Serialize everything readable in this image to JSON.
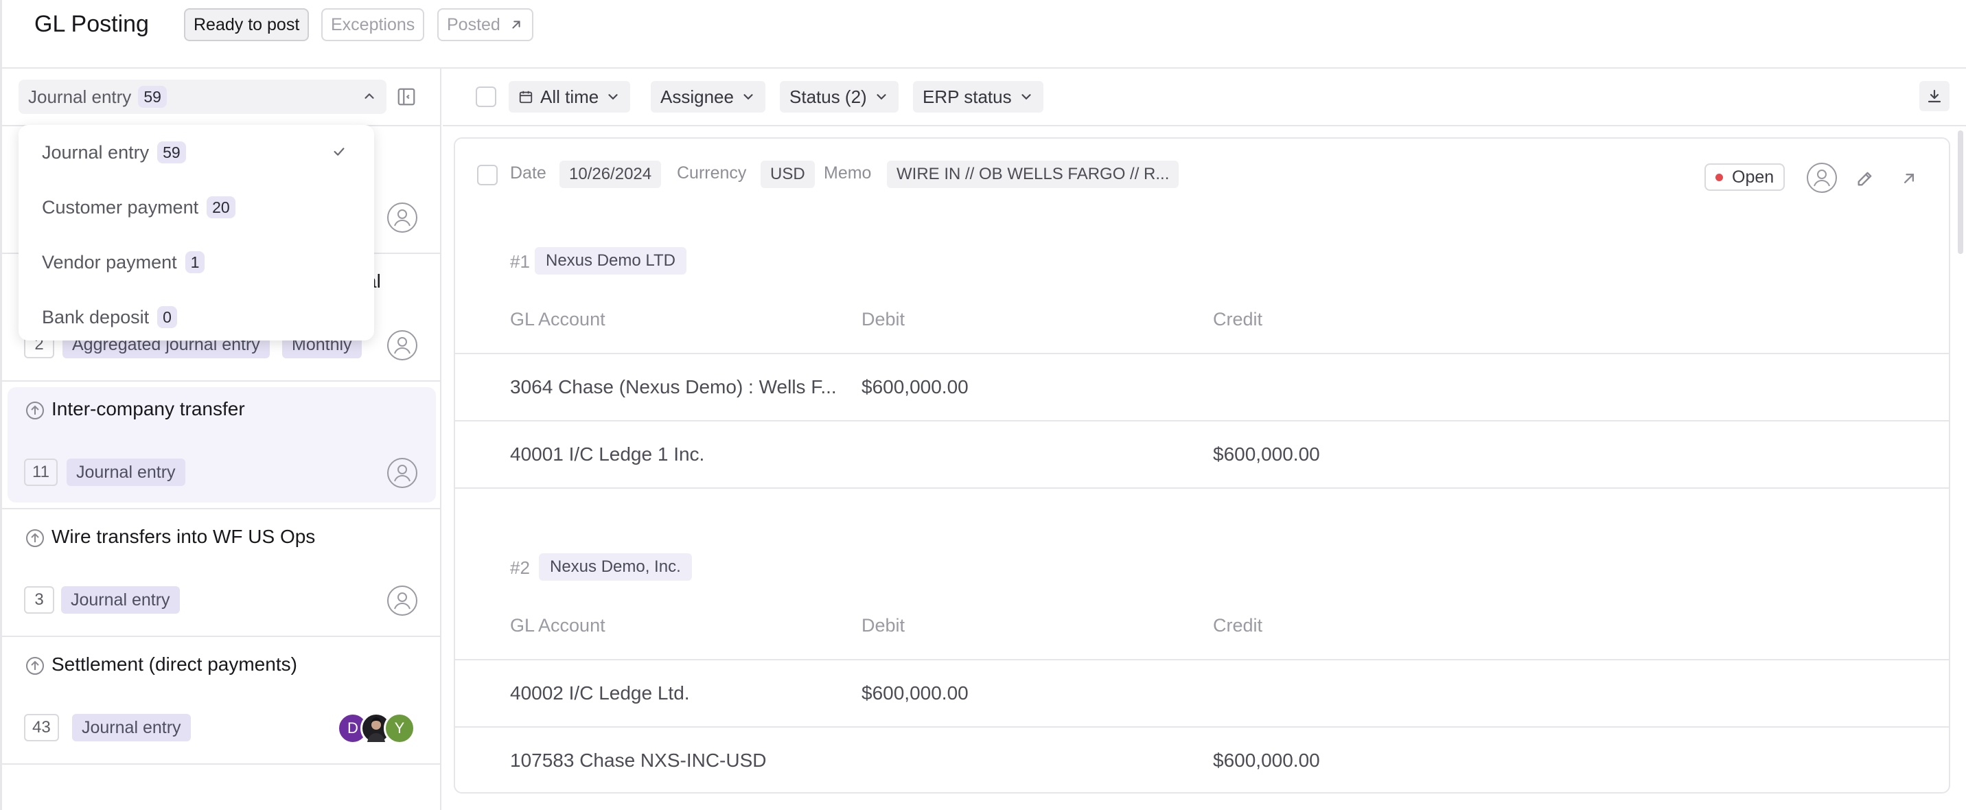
{
  "header": {
    "title": "GL Posting",
    "tabs": [
      {
        "label": "Ready to post",
        "active": true
      },
      {
        "label": "Exceptions",
        "active": false
      },
      {
        "label": "Posted",
        "active": false,
        "icon": "arrow-up-right-icon"
      }
    ]
  },
  "left": {
    "group_select": {
      "label": "Journal entry",
      "count": "59"
    },
    "dropdown": [
      {
        "label": "Journal entry",
        "count": "59",
        "checked": true
      },
      {
        "label": "Customer payment",
        "count": "20"
      },
      {
        "label": "Vendor payment",
        "count": "1"
      },
      {
        "label": "Bank deposit",
        "count": "0"
      }
    ],
    "items": [
      {
        "title": "",
        "count": "",
        "tags": []
      },
      {
        "title": "al",
        "count": "2",
        "tags": [
          "Aggregated journal entry",
          "Monthly"
        ]
      },
      {
        "title": "Inter-company transfer",
        "count": "11",
        "tags": [
          "Journal entry"
        ],
        "selected": true
      },
      {
        "title": "Wire transfers into WF US Ops",
        "count": "3",
        "tags": [
          "Journal entry"
        ]
      },
      {
        "title": "Settlement (direct payments)",
        "count": "43",
        "tags": [
          "Journal entry"
        ],
        "avatars": [
          "D",
          "",
          "Y"
        ]
      }
    ]
  },
  "toolbar": {
    "filters": [
      "All time",
      "Assignee",
      "Status (2)",
      "ERP status"
    ]
  },
  "card": {
    "date_label": "Date",
    "date_value": "10/26/2024",
    "currency_label": "Currency",
    "currency_value": "USD",
    "memo_label": "Memo",
    "memo_value": "WIRE IN // OB WELLS FARGO // R...",
    "status": "Open",
    "sections": [
      {
        "num": "#1",
        "entity": "Nexus Demo LTD",
        "headers": [
          "GL Account",
          "Debit",
          "Credit"
        ],
        "rows": [
          {
            "account": "3064 Chase (Nexus Demo) : Wells F...",
            "debit": "$600,000.00",
            "credit": ""
          },
          {
            "account": "40001 I/C Ledge 1 Inc.",
            "debit": "",
            "credit": "$600,000.00"
          }
        ]
      },
      {
        "num": "#2",
        "entity": "Nexus Demo, Inc.",
        "headers": [
          "GL Account",
          "Debit",
          "Credit"
        ],
        "rows": [
          {
            "account": "40002 I/C Ledge Ltd.",
            "debit": "$600,000.00",
            "credit": ""
          },
          {
            "account": "107583 Chase NXS-INC-USD",
            "debit": "",
            "credit": "$600,000.00"
          }
        ]
      }
    ]
  },
  "colors": {
    "accent_badge": "#e6e4f5",
    "tag": "#e3e1f3",
    "selected_bg": "#f4f3fb",
    "status_open_dot": "#e5484d",
    "avatar_d": "#6b2fa0",
    "avatar_y": "#6b9a3c"
  }
}
